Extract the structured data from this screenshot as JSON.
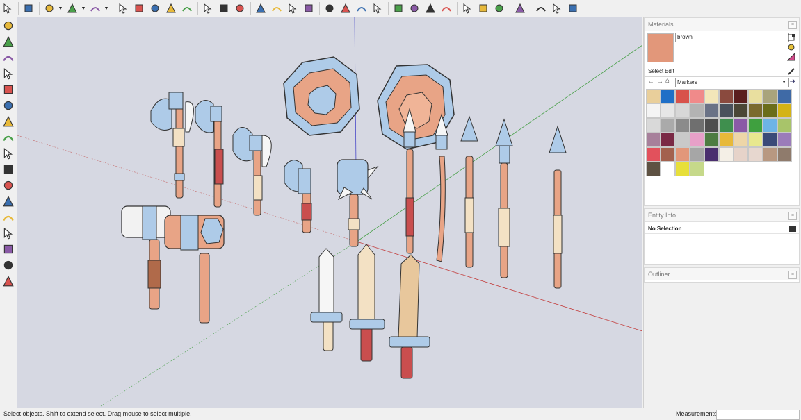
{
  "toolbar": {
    "icons": [
      "select-icon",
      "eraser-icon",
      "pencil-line-icon",
      "arc-icon",
      "paint-bucket-icon",
      "push-pull-icon",
      "follow-me-icon",
      "move-icon",
      "rotate-icon",
      "offset-icon",
      "tape-measure-icon",
      "text-icon",
      "section-plane-icon",
      "orbit-icon",
      "pan-icon",
      "zoom-icon",
      "zoom-extents-icon",
      "components-icon",
      "3d-warehouse-icon",
      "extension-warehouse-icon",
      "solid-tools-icon",
      "sandbox-icon",
      "intersect-icon",
      "flip-icon",
      "scale-icon",
      "undo-icon",
      "redo-icon",
      "view-icon",
      "curve-icon",
      "iso-view-icon",
      "top-view-icon",
      "front-view-icon"
    ]
  },
  "left_tools": [
    "orbit-tool-icon",
    "iso-icon",
    "top-icon",
    "front-icon",
    "right-icon",
    "back-icon",
    "left-icon",
    "bottom-icon",
    "section-icon",
    "walk-icon",
    "position-camera-icon",
    "look-around-icon",
    "xray-icon",
    "shaded-icon",
    "textured-icon",
    "monochrome-icon",
    "wireframe-icon"
  ],
  "materials": {
    "title": "Materials",
    "current_name": "brown",
    "current_color": "#e2977a",
    "tab_select": "Select",
    "tab_edit": "Edit",
    "collection": "Markers",
    "swatches": [
      "#e9cf9b",
      "#1f6fc7",
      "#d8524b",
      "#f08a8a",
      "#f3e6b9",
      "#8a4a3e",
      "#5a1e1e",
      "#e9df9f",
      "#a9a47c",
      "#3f6aa6",
      "#f4f4f4",
      "#e6e6e6",
      "#d7d7d7",
      "#b3b3b3",
      "#6a7286",
      "#4a515c",
      "#4b4636",
      "#7b6a2e",
      "#6b6d1b",
      "#d4b316",
      "#d9d9d9",
      "#aaaaaa",
      "#8b8b8b",
      "#6f6f6f",
      "#4e4e4e",
      "#3f8f4e",
      "#8a5aa6",
      "#3fa03f",
      "#6db4e6",
      "#a8c46a",
      "#a7809b",
      "#7a2945",
      "#c9c9c9",
      "#e7a0c8",
      "#4e7c42",
      "#e7b93a",
      "#eed6a8",
      "#e8e88f",
      "#3b4a78",
      "#9b7cba",
      "#e2515c",
      "#a3614e",
      "#e2977a",
      "#a6a6a6",
      "#4a2e6e",
      "#f4efe6",
      "#e6d3c9",
      "#e7d7cf",
      "#b89881",
      "#8f7b6c",
      "#5e5243",
      "#ffffff",
      "#e7df3a",
      "#c6d98a"
    ]
  },
  "entity_info": {
    "title": "Entity Info",
    "selection": "No Selection"
  },
  "outliner": {
    "title": "Outliner"
  },
  "status": {
    "hint": "Select objects. Shift to extend select. Drag mouse to select multiple.",
    "measurements_label": "Measurements",
    "measurements_value": ""
  }
}
